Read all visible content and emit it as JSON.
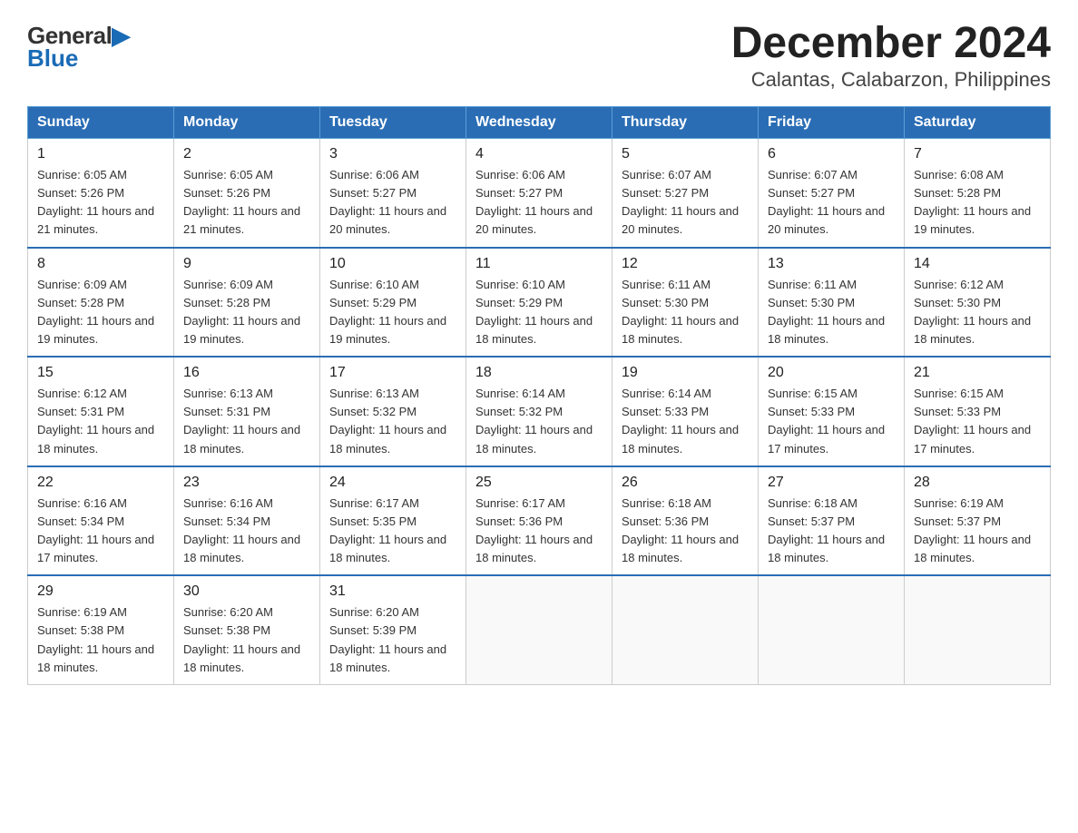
{
  "logo": {
    "general": "General",
    "blue": "Blue",
    "arrow": "▶"
  },
  "title": "December 2024",
  "subtitle": "Calantas, Calabarzon, Philippines",
  "days_header": [
    "Sunday",
    "Monday",
    "Tuesday",
    "Wednesday",
    "Thursday",
    "Friday",
    "Saturday"
  ],
  "weeks": [
    [
      {
        "day": "1",
        "sunrise": "6:05 AM",
        "sunset": "5:26 PM",
        "daylight": "11 hours and 21 minutes."
      },
      {
        "day": "2",
        "sunrise": "6:05 AM",
        "sunset": "5:26 PM",
        "daylight": "11 hours and 21 minutes."
      },
      {
        "day": "3",
        "sunrise": "6:06 AM",
        "sunset": "5:27 PM",
        "daylight": "11 hours and 20 minutes."
      },
      {
        "day": "4",
        "sunrise": "6:06 AM",
        "sunset": "5:27 PM",
        "daylight": "11 hours and 20 minutes."
      },
      {
        "day": "5",
        "sunrise": "6:07 AM",
        "sunset": "5:27 PM",
        "daylight": "11 hours and 20 minutes."
      },
      {
        "day": "6",
        "sunrise": "6:07 AM",
        "sunset": "5:27 PM",
        "daylight": "11 hours and 20 minutes."
      },
      {
        "day": "7",
        "sunrise": "6:08 AM",
        "sunset": "5:28 PM",
        "daylight": "11 hours and 19 minutes."
      }
    ],
    [
      {
        "day": "8",
        "sunrise": "6:09 AM",
        "sunset": "5:28 PM",
        "daylight": "11 hours and 19 minutes."
      },
      {
        "day": "9",
        "sunrise": "6:09 AM",
        "sunset": "5:28 PM",
        "daylight": "11 hours and 19 minutes."
      },
      {
        "day": "10",
        "sunrise": "6:10 AM",
        "sunset": "5:29 PM",
        "daylight": "11 hours and 19 minutes."
      },
      {
        "day": "11",
        "sunrise": "6:10 AM",
        "sunset": "5:29 PM",
        "daylight": "11 hours and 18 minutes."
      },
      {
        "day": "12",
        "sunrise": "6:11 AM",
        "sunset": "5:30 PM",
        "daylight": "11 hours and 18 minutes."
      },
      {
        "day": "13",
        "sunrise": "6:11 AM",
        "sunset": "5:30 PM",
        "daylight": "11 hours and 18 minutes."
      },
      {
        "day": "14",
        "sunrise": "6:12 AM",
        "sunset": "5:30 PM",
        "daylight": "11 hours and 18 minutes."
      }
    ],
    [
      {
        "day": "15",
        "sunrise": "6:12 AM",
        "sunset": "5:31 PM",
        "daylight": "11 hours and 18 minutes."
      },
      {
        "day": "16",
        "sunrise": "6:13 AM",
        "sunset": "5:31 PM",
        "daylight": "11 hours and 18 minutes."
      },
      {
        "day": "17",
        "sunrise": "6:13 AM",
        "sunset": "5:32 PM",
        "daylight": "11 hours and 18 minutes."
      },
      {
        "day": "18",
        "sunrise": "6:14 AM",
        "sunset": "5:32 PM",
        "daylight": "11 hours and 18 minutes."
      },
      {
        "day": "19",
        "sunrise": "6:14 AM",
        "sunset": "5:33 PM",
        "daylight": "11 hours and 18 minutes."
      },
      {
        "day": "20",
        "sunrise": "6:15 AM",
        "sunset": "5:33 PM",
        "daylight": "11 hours and 17 minutes."
      },
      {
        "day": "21",
        "sunrise": "6:15 AM",
        "sunset": "5:33 PM",
        "daylight": "11 hours and 17 minutes."
      }
    ],
    [
      {
        "day": "22",
        "sunrise": "6:16 AM",
        "sunset": "5:34 PM",
        "daylight": "11 hours and 17 minutes."
      },
      {
        "day": "23",
        "sunrise": "6:16 AM",
        "sunset": "5:34 PM",
        "daylight": "11 hours and 18 minutes."
      },
      {
        "day": "24",
        "sunrise": "6:17 AM",
        "sunset": "5:35 PM",
        "daylight": "11 hours and 18 minutes."
      },
      {
        "day": "25",
        "sunrise": "6:17 AM",
        "sunset": "5:36 PM",
        "daylight": "11 hours and 18 minutes."
      },
      {
        "day": "26",
        "sunrise": "6:18 AM",
        "sunset": "5:36 PM",
        "daylight": "11 hours and 18 minutes."
      },
      {
        "day": "27",
        "sunrise": "6:18 AM",
        "sunset": "5:37 PM",
        "daylight": "11 hours and 18 minutes."
      },
      {
        "day": "28",
        "sunrise": "6:19 AM",
        "sunset": "5:37 PM",
        "daylight": "11 hours and 18 minutes."
      }
    ],
    [
      {
        "day": "29",
        "sunrise": "6:19 AM",
        "sunset": "5:38 PM",
        "daylight": "11 hours and 18 minutes."
      },
      {
        "day": "30",
        "sunrise": "6:20 AM",
        "sunset": "5:38 PM",
        "daylight": "11 hours and 18 minutes."
      },
      {
        "day": "31",
        "sunrise": "6:20 AM",
        "sunset": "5:39 PM",
        "daylight": "11 hours and 18 minutes."
      },
      null,
      null,
      null,
      null
    ]
  ]
}
